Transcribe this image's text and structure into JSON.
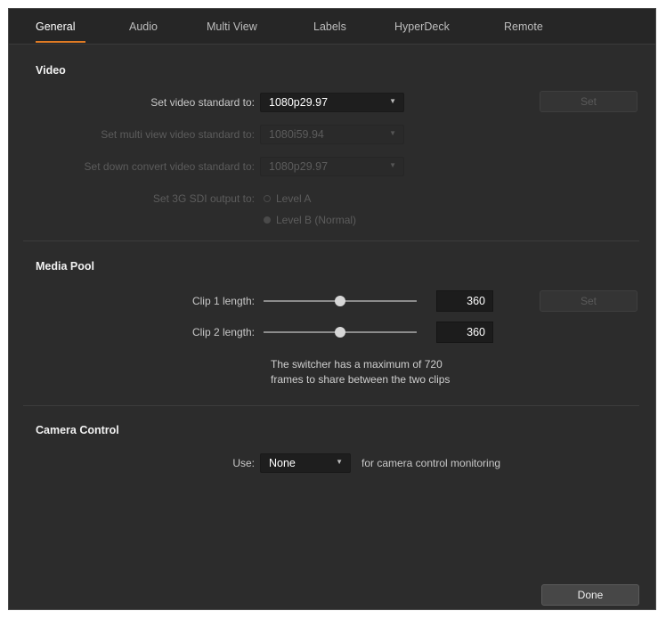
{
  "tabs": [
    {
      "label": "General",
      "active": true
    },
    {
      "label": "Audio"
    },
    {
      "label": "Multi View"
    },
    {
      "label": "Labels"
    },
    {
      "label": "HyperDeck"
    },
    {
      "label": "Remote"
    }
  ],
  "video": {
    "title": "Video",
    "standard_label": "Set video standard to:",
    "standard_value": "1080p29.97",
    "multiview_label": "Set multi view video standard to:",
    "multiview_value": "1080i59.94",
    "downconvert_label": "Set down convert video standard to:",
    "downconvert_value": "1080p29.97",
    "sdi_label": "Set 3G SDI output to:",
    "sdi_option_a": "Level A",
    "sdi_option_b": "Level B (Normal)",
    "set_button": "Set"
  },
  "media_pool": {
    "title": "Media Pool",
    "clip1_label": "Clip 1 length:",
    "clip1_value": "360",
    "clip1_fraction": 0.5,
    "clip2_label": "Clip 2 length:",
    "clip2_value": "360",
    "clip2_fraction": 0.5,
    "set_button": "Set",
    "info_line1": "The switcher has a maximum of 720",
    "info_line2": "frames to share between the two clips"
  },
  "camera_control": {
    "title": "Camera Control",
    "use_label": "Use:",
    "use_value": "None",
    "suffix": "for camera control monitoring"
  },
  "footer": {
    "done_button": "Done"
  },
  "icons": {
    "dropdown_caret": "chevron-down-icon"
  },
  "colors": {
    "accent": "#e07b24",
    "background": "#2c2c2c"
  }
}
